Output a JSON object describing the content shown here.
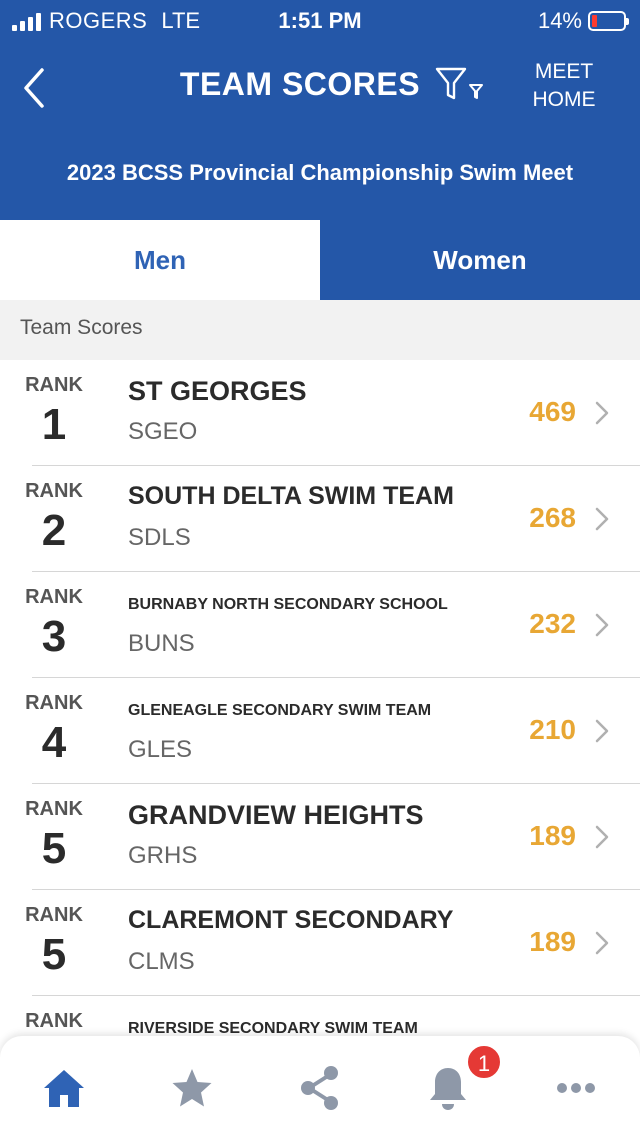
{
  "status_bar": {
    "carrier": "ROGERS",
    "network": "LTE",
    "time": "1:51 PM",
    "battery": "14%",
    "battery_level": 0.14
  },
  "header": {
    "title": "TEAM SCORES",
    "meet_home_line1": "MEET",
    "meet_home_line2": "HOME",
    "subtitle": "2023 BCSS Provincial Championship Swim Meet"
  },
  "tabs": [
    {
      "label": "Men",
      "active": true
    },
    {
      "label": "Women",
      "active": false
    }
  ],
  "section_title": "Team Scores",
  "rank_label": "RANK",
  "teams": [
    {
      "rank": "1",
      "name": "ST GEORGES",
      "abbr": "SGEO",
      "score": "469"
    },
    {
      "rank": "2",
      "name": "SOUTH DELTA SWIM TEAM",
      "abbr": "SDLS",
      "score": "268"
    },
    {
      "rank": "3",
      "name": "BURNABY NORTH SECONDARY SCHOOL",
      "abbr": "BUNS",
      "score": "232"
    },
    {
      "rank": "4",
      "name": "GLENEAGLE SECONDARY SWIM TEAM",
      "abbr": "GLES",
      "score": "210"
    },
    {
      "rank": "5",
      "name": "GRANDVIEW HEIGHTS",
      "abbr": "GRHS",
      "score": "189"
    },
    {
      "rank": "5",
      "name": "CLAREMONT SECONDARY",
      "abbr": "CLMS",
      "score": "189"
    },
    {
      "rank": "",
      "name": "RIVERSIDE SECONDARY SWIM TEAM",
      "abbr": "",
      "score": ""
    }
  ],
  "bottom_nav": {
    "items": [
      "home-icon",
      "star-icon",
      "share-icon",
      "bell-icon",
      "more-icon"
    ],
    "notification_count": "1"
  },
  "colors": {
    "header_blue": "#2457a8",
    "tab_active_text": "#2f63b5",
    "score_gold": "#e8a734",
    "badge_red": "#e53935"
  }
}
